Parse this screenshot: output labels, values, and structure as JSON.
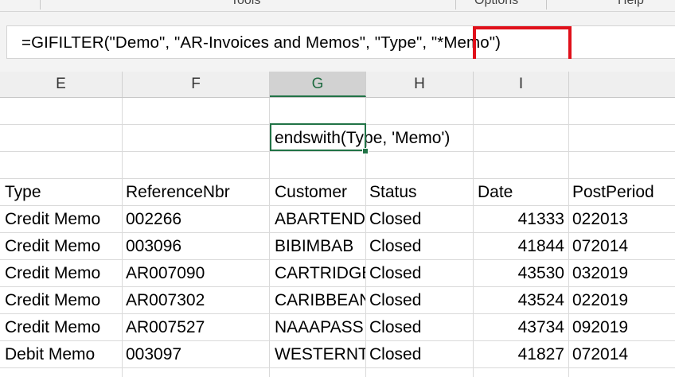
{
  "ribbon": {
    "groups": [
      "Tools",
      "Options",
      "Help"
    ]
  },
  "formula_bar": {
    "formula": "=GIFILTER(\"Demo\", \"AR-Invoices and Memos\", \"Type\", \"*Memo\")",
    "highlighted_argument": "\"*Memo\")"
  },
  "columns": [
    "E",
    "F",
    "G",
    "H",
    "I"
  ],
  "selected_column": "G",
  "selected_cell": {
    "text": "endswith(Type, 'Memo')"
  },
  "table": {
    "headers": [
      "Type",
      "ReferenceNbr",
      "Customer",
      "Status",
      "Date",
      "PostPeriod"
    ],
    "rows": [
      [
        "Credit Memo",
        "002266",
        "ABARTENDE",
        "Closed",
        "41333",
        "022013"
      ],
      [
        "Credit Memo",
        "003096",
        "BIBIMBAB",
        "Closed",
        "41844",
        "072014"
      ],
      [
        "Credit Memo",
        "AR007090",
        "CARTRIDGE",
        "Closed",
        "43530",
        "032019"
      ],
      [
        "Credit Memo",
        "AR007302",
        "CARIBBEAN",
        "Closed",
        "43524",
        "022019"
      ],
      [
        "Credit Memo",
        "AR007527",
        "NAAAPASS",
        "Closed",
        "43734",
        "092019"
      ],
      [
        "Debit Memo",
        "003097",
        "WESTERNT",
        "Closed",
        "41827",
        "072014"
      ]
    ]
  },
  "colors": {
    "highlight_box": "#e0101a",
    "selection_green": "#217346"
  }
}
